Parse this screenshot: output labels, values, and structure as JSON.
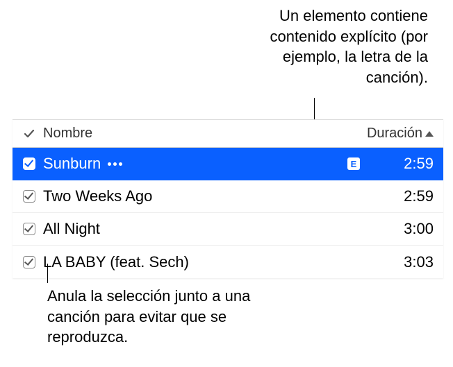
{
  "callouts": {
    "top": "Un elemento contiene contenido explícito (por ejemplo, la letra de la canción).",
    "bottom": "Anula la selección junto a una canción para evitar que se reproduzca."
  },
  "table": {
    "columns": {
      "name": "Nombre",
      "duration": "Duración"
    },
    "rows": [
      {
        "checked": true,
        "name": "Sunburn",
        "explicit": true,
        "duration": "2:59",
        "selected": true
      },
      {
        "checked": true,
        "name": "Two Weeks Ago",
        "explicit": false,
        "duration": "2:59",
        "selected": false
      },
      {
        "checked": true,
        "name": "All Night",
        "explicit": false,
        "duration": "3:00",
        "selected": false
      },
      {
        "checked": true,
        "name": "LA BABY (feat. Sech)",
        "explicit": false,
        "duration": "3:03",
        "selected": false
      }
    ],
    "explicit_badge": "E"
  }
}
